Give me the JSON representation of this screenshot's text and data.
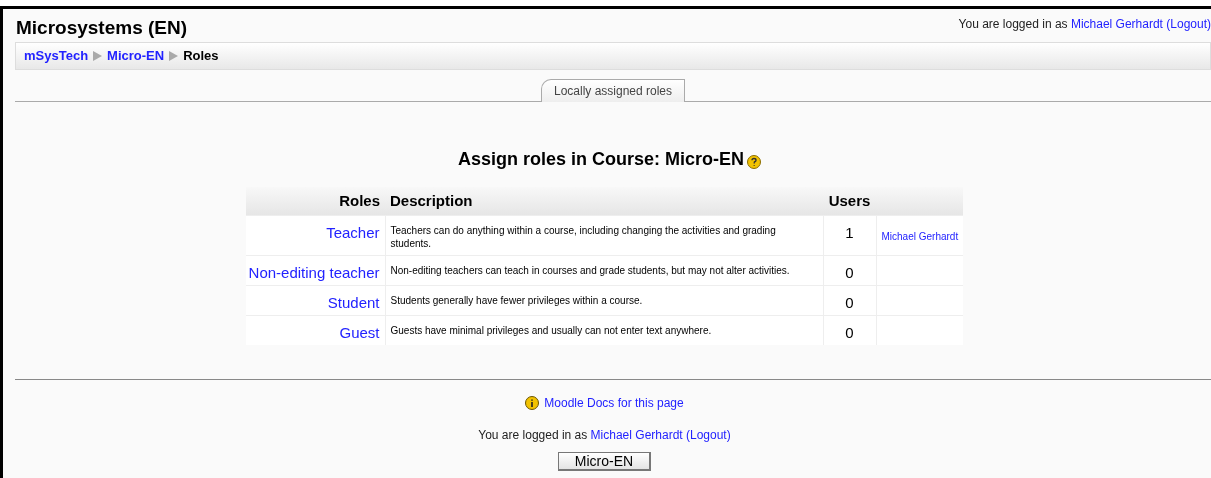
{
  "header": {
    "title": "Microsystems (EN)",
    "login": {
      "prefix": "You are logged in as",
      "user": "Michael Gerhardt",
      "logout": "(Logout)"
    }
  },
  "breadcrumb": [
    {
      "label": "mSysTech",
      "kind": "link"
    },
    {
      "label": "Micro-EN",
      "kind": "link"
    },
    {
      "label": "Roles",
      "kind": "current"
    }
  ],
  "tabs": [
    {
      "label": "Locally assigned roles",
      "selected": true
    }
  ],
  "heading": "Assign roles in Course: Micro-EN",
  "table": {
    "columns": [
      "Roles",
      "Description",
      "Users"
    ],
    "rows": [
      {
        "role": "Teacher",
        "description": "Teachers can do anything within a course, including changing the activities and grading students.",
        "users": "1",
        "user_list": "Michael Gerhardt"
      },
      {
        "role": "Non-editing teacher",
        "description": "Non-editing teachers can teach in courses and grade students, but may not alter activities.",
        "users": "0"
      },
      {
        "role": "Student",
        "description": "Students generally have fewer privileges within a course.",
        "users": "0"
      },
      {
        "role": "Guest",
        "description": "Guests have minimal privileges and usually can not enter text anywhere.",
        "users": "0"
      }
    ]
  },
  "footer": {
    "docs_link": "Moodle Docs for this page",
    "login": {
      "prefix": "You are logged in as",
      "user": "Michael Gerhardt",
      "logout": "(Logout)"
    },
    "button": "Micro-EN"
  }
}
